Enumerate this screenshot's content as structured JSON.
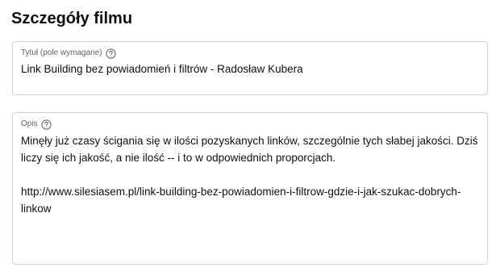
{
  "page": {
    "title": "Szczegóły filmu"
  },
  "title_field": {
    "label": "Tytuł (pole wymagane)",
    "value": "Link Building bez powiadomień i filtrów - Radosław Kubera",
    "help_icon": "help-circle-icon"
  },
  "description_field": {
    "label": "Opis",
    "paragraph_1": "Minęły już czasy ścigania się w ilości pozyskanych linków, szczególnie tych słabej jakości. Dziś liczy się ich jakość, a nie ilość -- i to w odpowiednich proporcjach.",
    "paragraph_2": "http://www.silesiasem.pl/link-building-bez-powiadomien-i-filtrow-gdzie-i-jak-szukac-dobrych-linkow",
    "help_icon": "help-circle-icon"
  },
  "colors": {
    "border": "#d3d3d3",
    "label": "#606060",
    "text": "#0f0f0f"
  }
}
